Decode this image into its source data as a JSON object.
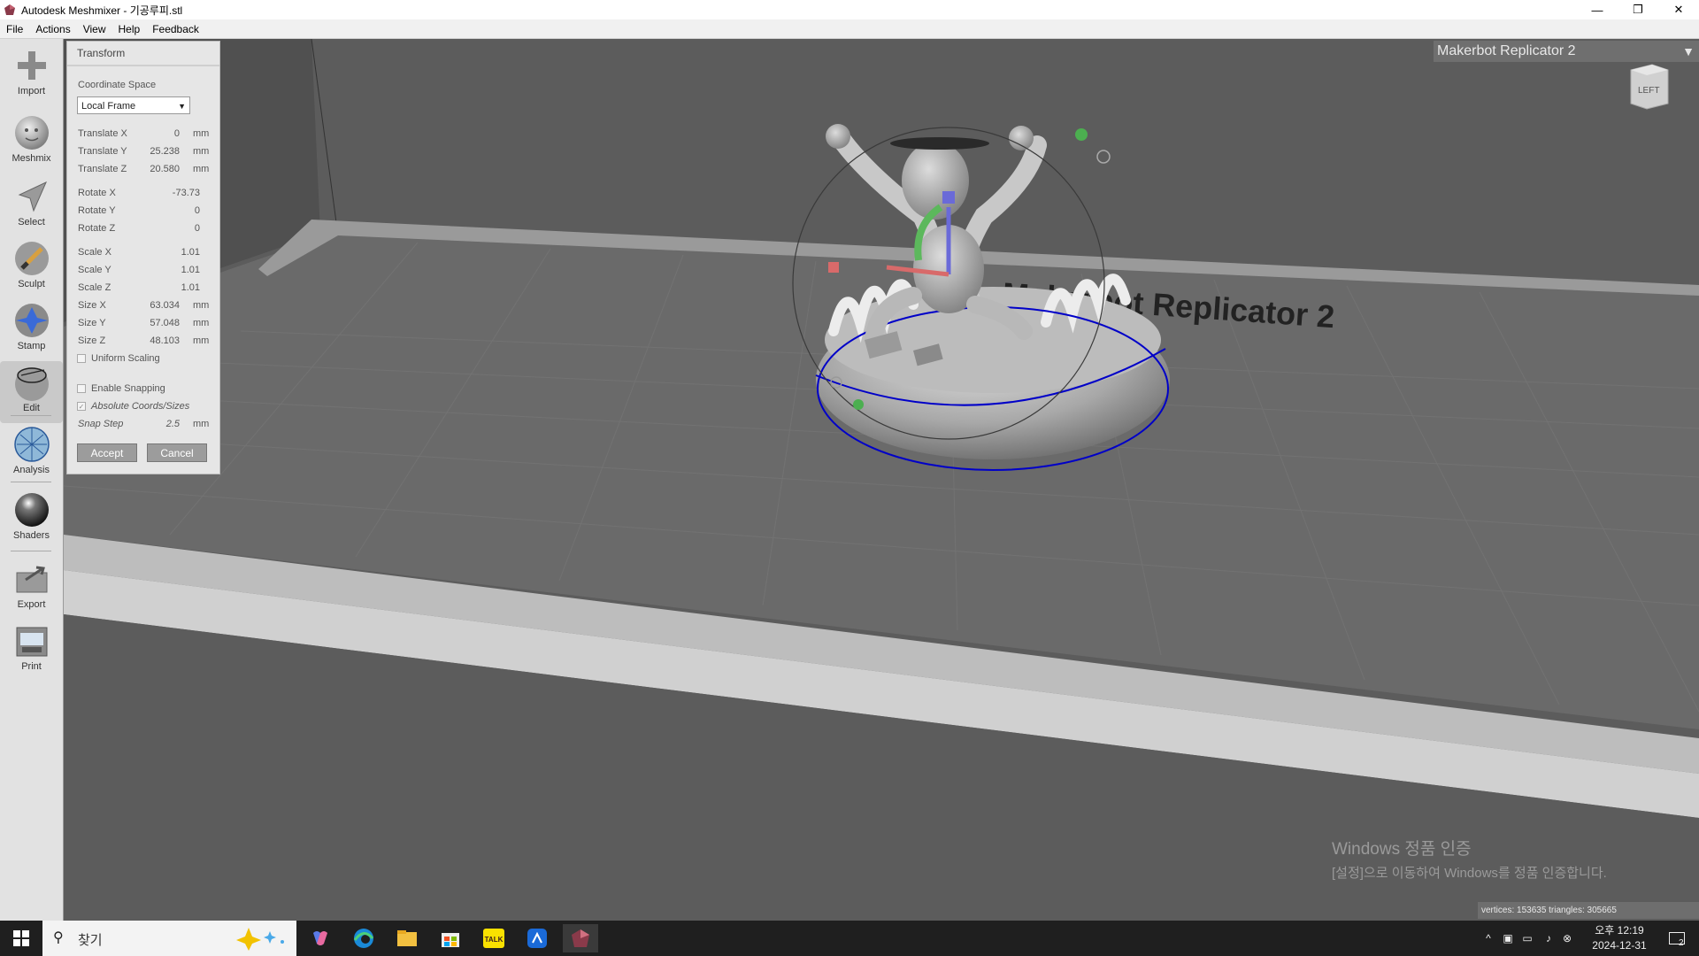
{
  "window": {
    "title": "Autodesk Meshmixer - 기공루피.stl",
    "minimize": "—",
    "restore": "❐",
    "close": "✕"
  },
  "menu": [
    "File",
    "Actions",
    "View",
    "Help",
    "Feedback"
  ],
  "tools": [
    {
      "label": "Import",
      "icon": "plus-icon"
    },
    {
      "label": "Meshmix",
      "icon": "meshmix-head-icon"
    },
    {
      "label": "Select",
      "icon": "select-arrow-icon"
    },
    {
      "label": "Sculpt",
      "icon": "sculpt-brush-icon"
    },
    {
      "label": "Stamp",
      "icon": "stamp-icon"
    },
    {
      "label": "Edit",
      "icon": "edit-sphere-icon"
    },
    {
      "label": "Analysis",
      "icon": "analysis-globe-icon"
    },
    {
      "label": "Shaders",
      "icon": "shader-sphere-icon"
    },
    {
      "label": "Export",
      "icon": "export-folder-icon"
    },
    {
      "label": "Print",
      "icon": "print-icon"
    }
  ],
  "panel": {
    "title": "Transform",
    "coord_label": "Coordinate Space",
    "coord_value": "Local Frame",
    "fields": [
      {
        "label": "Translate X",
        "value": "0",
        "unit": "mm"
      },
      {
        "label": "Translate Y",
        "value": "25.238",
        "unit": "mm"
      },
      {
        "label": "Translate Z",
        "value": "20.580",
        "unit": "mm"
      },
      {
        "label": "Rotate X",
        "value": "-73.73",
        "unit": ""
      },
      {
        "label": "Rotate Y",
        "value": "0",
        "unit": ""
      },
      {
        "label": "Rotate Z",
        "value": "0",
        "unit": ""
      },
      {
        "label": "Scale X",
        "value": "1.01",
        "unit": ""
      },
      {
        "label": "Scale Y",
        "value": "1.01",
        "unit": ""
      },
      {
        "label": "Scale Z",
        "value": "1.01",
        "unit": ""
      },
      {
        "label": "Size X",
        "value": "63.034",
        "unit": "mm"
      },
      {
        "label": "Size Y",
        "value": "57.048",
        "unit": "mm"
      },
      {
        "label": "Size Z",
        "value": "48.103",
        "unit": "mm"
      }
    ],
    "uniform_scaling": "Uniform Scaling",
    "enable_snapping": "Enable Snapping",
    "absolute_coords": "Absolute Coords/Sizes",
    "snap_step_label": "Snap Step",
    "snap_step_value": "2.5",
    "snap_step_unit": "mm",
    "accept": "Accept",
    "cancel": "Cancel"
  },
  "viewport": {
    "printer": "Makerbot Replicator 2",
    "cube_label": "LEFT",
    "stats": "vertices: 153635 triangles: 305665",
    "watermark_title": "Windows 정품 인증",
    "watermark_sub": "[설정]으로 이동하여 Windows를 정품 인증합니다."
  },
  "taskbar": {
    "search_placeholder": "찾기",
    "clock_time": "오후 12:19",
    "clock_date": "2024-12-31",
    "notification_count": "2"
  }
}
